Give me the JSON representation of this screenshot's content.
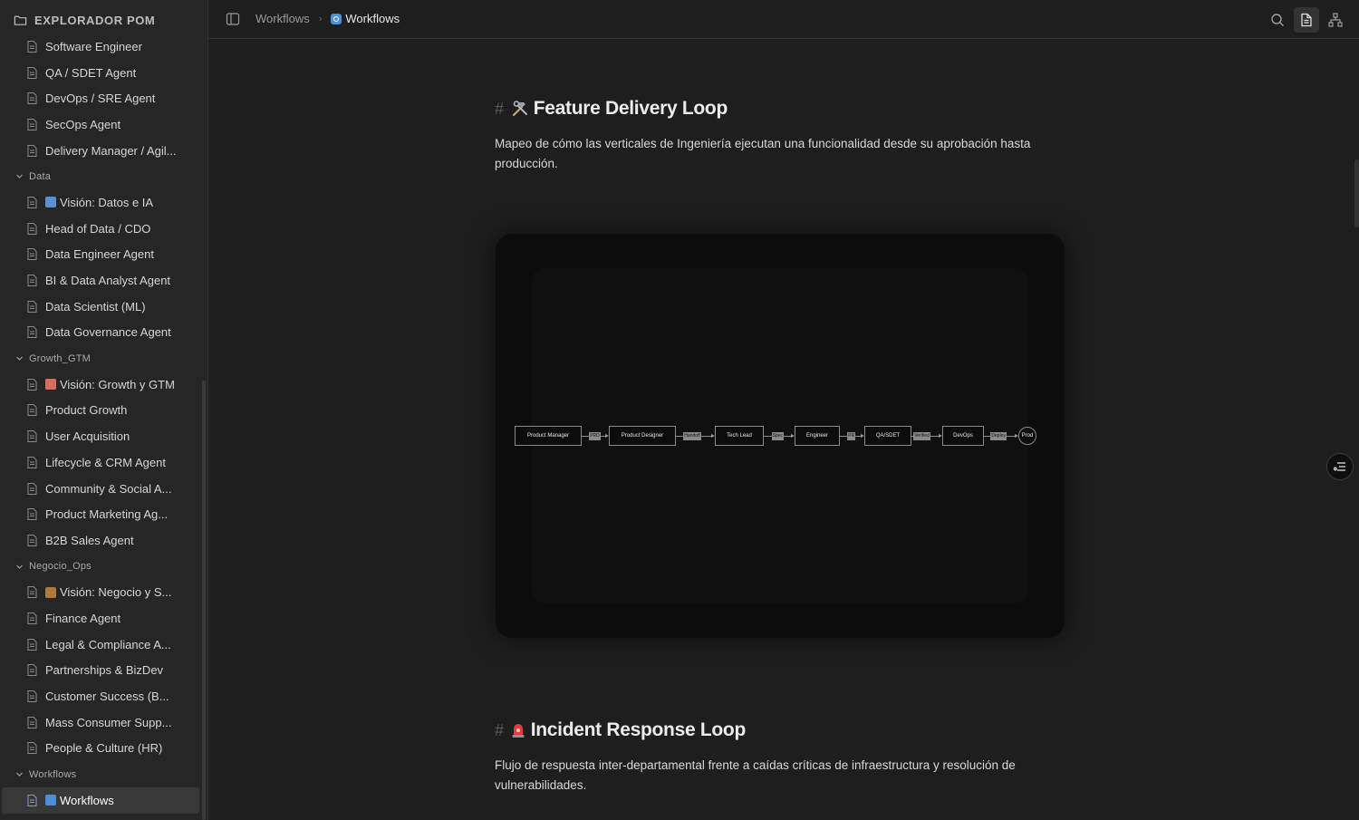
{
  "sidebar": {
    "title": "EXPLORADOR POM",
    "items": [
      {
        "type": "doc",
        "label": "Software Engineer"
      },
      {
        "type": "doc",
        "label": "QA / SDET Agent"
      },
      {
        "type": "doc",
        "label": "DevOps / SRE Agent"
      },
      {
        "type": "doc",
        "label": "SecOps Agent"
      },
      {
        "type": "doc",
        "label": "Delivery Manager / Agil..."
      },
      {
        "type": "folder",
        "label": "Data"
      },
      {
        "type": "doc",
        "label": "Visión: Datos e IA",
        "emoji": "chart-emoji"
      },
      {
        "type": "doc",
        "label": "Head of Data / CDO"
      },
      {
        "type": "doc",
        "label": "Data Engineer Agent"
      },
      {
        "type": "doc",
        "label": "BI & Data Analyst Agent"
      },
      {
        "type": "doc",
        "label": "Data Scientist (ML)"
      },
      {
        "type": "doc",
        "label": "Data Governance Agent"
      },
      {
        "type": "folder",
        "label": "Growth_GTM"
      },
      {
        "type": "doc",
        "label": "Visión: Growth y GTM",
        "emoji": "rocket-emoji"
      },
      {
        "type": "doc",
        "label": "Product Growth"
      },
      {
        "type": "doc",
        "label": "User Acquisition"
      },
      {
        "type": "doc",
        "label": "Lifecycle & CRM Agent"
      },
      {
        "type": "doc",
        "label": "Community & Social A..."
      },
      {
        "type": "doc",
        "label": "Product Marketing Ag..."
      },
      {
        "type": "doc",
        "label": "B2B Sales Agent"
      },
      {
        "type": "folder",
        "label": "Negocio_Ops"
      },
      {
        "type": "doc",
        "label": "Visión: Negocio y S...",
        "emoji": "briefcase-emoji"
      },
      {
        "type": "doc",
        "label": "Finance Agent"
      },
      {
        "type": "doc",
        "label": "Legal & Compliance A..."
      },
      {
        "type": "doc",
        "label": "Partnerships & BizDev"
      },
      {
        "type": "doc",
        "label": "Customer Success (B..."
      },
      {
        "type": "doc",
        "label": "Mass Consumer Supp..."
      },
      {
        "type": "doc",
        "label": "People & Culture (HR)"
      },
      {
        "type": "folder",
        "label": "Workflows"
      },
      {
        "type": "doc",
        "label": "Workflows",
        "emoji": "sync-emoji",
        "active": true
      }
    ]
  },
  "topbar": {
    "crumb_parent": "Workflows",
    "crumb_current": "Workflows",
    "icons": [
      "sidebar-toggle-icon",
      "search-icon",
      "document-view-icon",
      "graph-view-icon"
    ]
  },
  "content": {
    "section1": {
      "hash": "#",
      "title": "Feature Delivery Loop",
      "emoji": "hammer-wrench-emoji",
      "description": "Mapeo de cómo las verticales de Ingeniería ejecutan una funcionalidad desde su aprobación hasta producción."
    },
    "flow": {
      "nodes": [
        "Product Manager",
        "Product Designer",
        "Tech Lead",
        "Engineer",
        "QA/SDET",
        "DevOps",
        "Prod"
      ],
      "edge_labels": [
        "PRD",
        "Handoff",
        "Spec",
        "PR",
        "Verified",
        "Deploy"
      ]
    },
    "section2": {
      "hash": "#",
      "title": "Incident Response Loop",
      "emoji": "siren-emoji",
      "description": "Flujo de respuesta inter-departamental frente a caídas críticas de infraestructura y resolución de vulnerabilidades."
    }
  },
  "colors": {
    "background": "#1e1e1e",
    "sidebar": "#262626",
    "accent": "#8a8cff",
    "diagram_bg": "#0c0c0c"
  }
}
